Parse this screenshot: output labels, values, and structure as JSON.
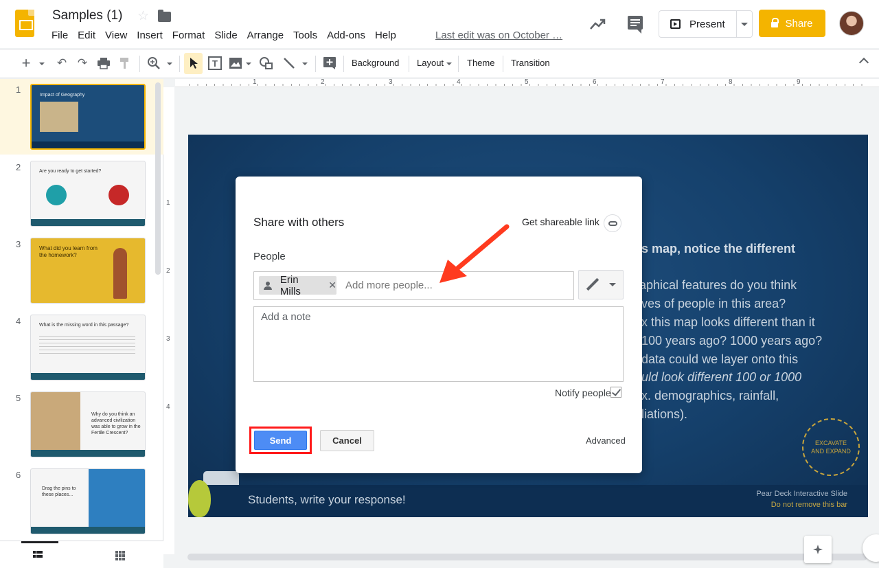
{
  "header": {
    "doc_title": "Samples (1)",
    "menu": [
      "File",
      "Edit",
      "View",
      "Insert",
      "Format",
      "Slide",
      "Arrange",
      "Tools",
      "Add-ons",
      "Help"
    ],
    "last_edit": "Last edit was on October …",
    "present_label": "Present",
    "share_label": "Share"
  },
  "toolbar": {
    "background": "Background",
    "layout": "Layout",
    "theme": "Theme",
    "transition": "Transition"
  },
  "ruler": {
    "h_ticks": [
      "1",
      "2",
      "3",
      "4",
      "5",
      "6",
      "7",
      "8",
      "9"
    ],
    "v_ticks": [
      "1",
      "2",
      "3",
      "4"
    ]
  },
  "filmstrip": {
    "slides": [
      {
        "num": "1",
        "title": "Impact of Geography"
      },
      {
        "num": "2",
        "title": "Are you ready to get started?"
      },
      {
        "num": "3",
        "title": "What did you learn from the homework?"
      },
      {
        "num": "4",
        "title": "What is the missing word in this passage?"
      },
      {
        "num": "5",
        "title": "Why do you think an advanced civilization was able to grow in the Fertile Crescent?"
      },
      {
        "num": "6",
        "title": "Drag the pins to these places..."
      }
    ]
  },
  "slide": {
    "lines": [
      "s map, notice the different",
      "aphical features do you think",
      "ves of people in this area?",
      "x this map looks different than it",
      "100 years ago? 1000 years ago?",
      "data could we layer onto this",
      "uld look different 100 or 1000",
      "x. demographics, rainfall,",
      "liations)."
    ],
    "bar_text": "Students, write your response!",
    "pd_title": "Pear Deck Interactive Slide",
    "pd_sub": "Do not remove this bar",
    "badge": "EXCAVATE AND EXPAND"
  },
  "dialog": {
    "title": "Share with others",
    "get_link": "Get shareable link",
    "people_label": "People",
    "chip_name": "Erin Mills",
    "add_people_placeholder": "Add more people...",
    "note_placeholder": "Add a note",
    "notify_label": "Notify people",
    "send_label": "Send",
    "cancel_label": "Cancel",
    "advanced_label": "Advanced"
  },
  "colors": {
    "brand_yellow": "#f4b400",
    "send_blue": "#4d8cf5",
    "highlight_red": "#ff1a1a",
    "slide_blue": "#15406b"
  }
}
